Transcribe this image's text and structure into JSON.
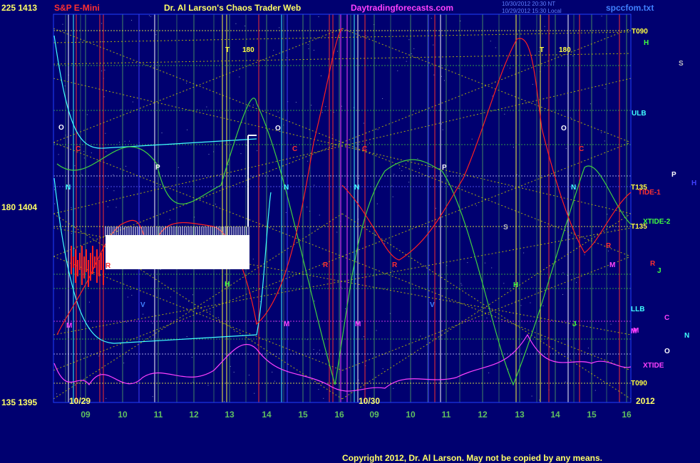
{
  "header": {
    "symbol": "S&P E-Mini",
    "title": "Dr. Al Larson's Chaos Trader Web",
    "site": "Daytradingforecasts.com",
    "timestamp1": "10/30/2012 20:30 NT",
    "timestamp2": "10/29/2012 15:30 Local",
    "filename": "spccfom.txt"
  },
  "y_axis": {
    "top": "225 1413",
    "mid": "180 1404",
    "bottom": "135 1395"
  },
  "x_axis": {
    "date_left": "10/29",
    "date_right": "10/30",
    "year": "2012",
    "hours": [
      "09",
      "10",
      "11",
      "12",
      "13",
      "14",
      "15",
      "16",
      "09",
      "10",
      "11",
      "12",
      "13",
      "14",
      "15",
      "16"
    ]
  },
  "footer": {
    "copyright": "Copyright 2012, Dr. Al Larson. May not be copied by any means."
  },
  "colors": {
    "background": "#000070",
    "price": "#ff2020",
    "cyan_flow": "#40ffff",
    "green_flow": "#40d040",
    "magenta_flow": "#ff40ff",
    "grid_yellow": "#c8c800",
    "grid_green": "#60c060"
  },
  "chart_data": {
    "type": "line",
    "y_range_price": [
      1395,
      1413
    ],
    "y_range_angle": [
      135,
      225
    ],
    "series": [],
    "right_labels": [
      {
        "text": "T090",
        "color": "#ffff40"
      },
      {
        "text": "H",
        "color": "#40ff40"
      },
      {
        "text": "S",
        "color": "#c0c0c0"
      },
      {
        "text": "ULB",
        "color": "#40ffff"
      },
      {
        "text": "P",
        "color": "#ffffff"
      },
      {
        "text": "H",
        "color": "#4040ff"
      },
      {
        "text": "T135",
        "color": "#ffff40"
      },
      {
        "text": "TIDE-1",
        "color": "#ff3030"
      },
      {
        "text": "XTIDE-2",
        "color": "#40ff40"
      },
      {
        "text": "T135",
        "color": "#ffff40"
      },
      {
        "text": "R",
        "color": "#ff3030"
      },
      {
        "text": "J",
        "color": "#40ff40"
      },
      {
        "text": "LLB",
        "color": "#40ffff"
      },
      {
        "text": "C",
        "color": "#ff40ff"
      },
      {
        "text": "N",
        "color": "#40ffff"
      },
      {
        "text": "M",
        "color": "#ff40ff"
      },
      {
        "text": "O",
        "color": "#ffffff"
      },
      {
        "text": "XTIDE",
        "color": "#ff40ff"
      },
      {
        "text": "T090",
        "color": "#ffff40"
      }
    ],
    "plot_markers": [
      {
        "text": "O",
        "color": "#ffffff"
      },
      {
        "text": "C",
        "color": "#ff3030"
      },
      {
        "text": "N",
        "color": "#40ffff"
      },
      {
        "text": "P",
        "color": "#ffffff"
      },
      {
        "text": "R",
        "color": "#ff3030"
      },
      {
        "text": "V",
        "color": "#4080ff"
      },
      {
        "text": "M",
        "color": "#ff40ff"
      },
      {
        "text": "T",
        "color": "#ffff40"
      },
      {
        "text": "180",
        "color": "#ffff40"
      },
      {
        "text": "H",
        "color": "#40ff40"
      },
      {
        "text": "O",
        "color": "#ffffff"
      },
      {
        "text": "C",
        "color": "#ff3030"
      },
      {
        "text": "N",
        "color": "#40ffff"
      },
      {
        "text": "R",
        "color": "#ff3030"
      },
      {
        "text": "M",
        "color": "#ff40ff"
      },
      {
        "text": "C",
        "color": "#ff3030"
      },
      {
        "text": "N",
        "color": "#40ffff"
      },
      {
        "text": "P",
        "color": "#ffffff"
      },
      {
        "text": "R",
        "color": "#ff3030"
      },
      {
        "text": "V",
        "color": "#4080ff"
      },
      {
        "text": "M",
        "color": "#ff40ff"
      },
      {
        "text": "S",
        "color": "#c0c0c0"
      },
      {
        "text": "H",
        "color": "#40ff40"
      },
      {
        "text": "T",
        "color": "#ffff40"
      },
      {
        "text": "180",
        "color": "#ffff40"
      },
      {
        "text": "O",
        "color": "#ffffff"
      },
      {
        "text": "N",
        "color": "#40ffff"
      },
      {
        "text": "C",
        "color": "#ff3030"
      },
      {
        "text": "M",
        "color": "#ff40ff"
      },
      {
        "text": "R",
        "color": "#ff3030"
      },
      {
        "text": "J",
        "color": "#40ff40"
      },
      {
        "text": "M",
        "color": "#ff40ff"
      },
      {
        "text": "M",
        "color": "#ff40ff"
      }
    ]
  }
}
